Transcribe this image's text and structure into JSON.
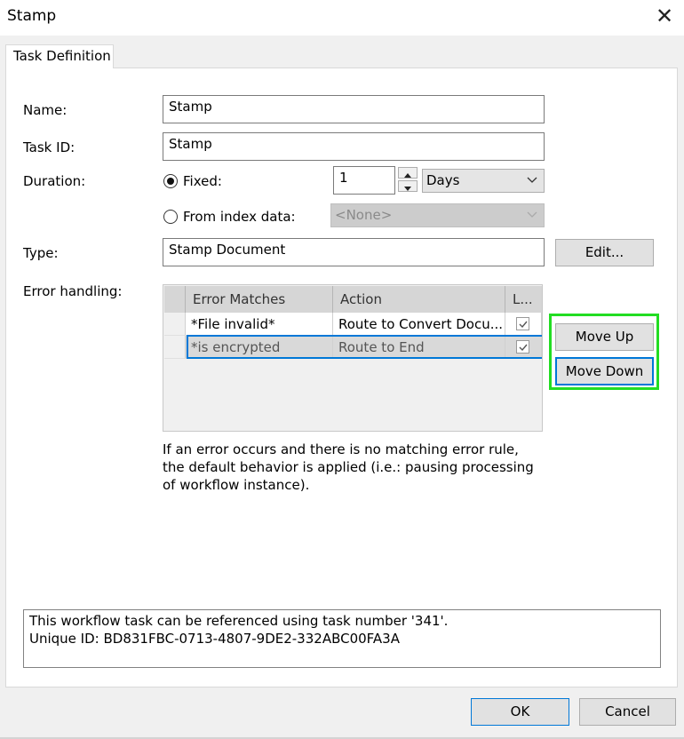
{
  "window": {
    "title": "Stamp"
  },
  "tabs": [
    {
      "label": "Task Definition"
    }
  ],
  "form": {
    "name_label": "Name:",
    "name_value": "Stamp",
    "taskid_label": "Task ID:",
    "taskid_value": "Stamp",
    "duration_label": "Duration:",
    "fixed_label": "Fixed:",
    "fixed_selected": true,
    "fixed_amount": "1",
    "fixed_unit": "Days",
    "index_label": "From index data:",
    "index_value": "<None>",
    "type_label": "Type:",
    "type_value": "Stamp Document",
    "edit_button": "Edit..."
  },
  "error_handling": {
    "label": "Error handling:",
    "columns": [
      "Error Matches",
      "Action",
      "L..."
    ],
    "rows": [
      {
        "match": "*File invalid*",
        "action": "Route to Convert Docu...",
        "checked": true
      },
      {
        "match": "*is encrypted",
        "action": "Route to End",
        "checked": true
      }
    ],
    "move_up": "Move Up",
    "move_down": "Move Down",
    "note": "If an error occurs and there is no matching error rule, the default behavior is applied (i.e.: pausing processing of workflow instance)."
  },
  "reference": {
    "line1": "This workflow task can be referenced using task number '341'.",
    "line2": "Unique ID: BD831FBC-0713-4807-9DE2-332ABC00FA3A"
  },
  "buttons": {
    "ok": "OK",
    "cancel": "Cancel"
  },
  "colors": {
    "highlight": "#22dd22",
    "focus": "#0078d7"
  }
}
